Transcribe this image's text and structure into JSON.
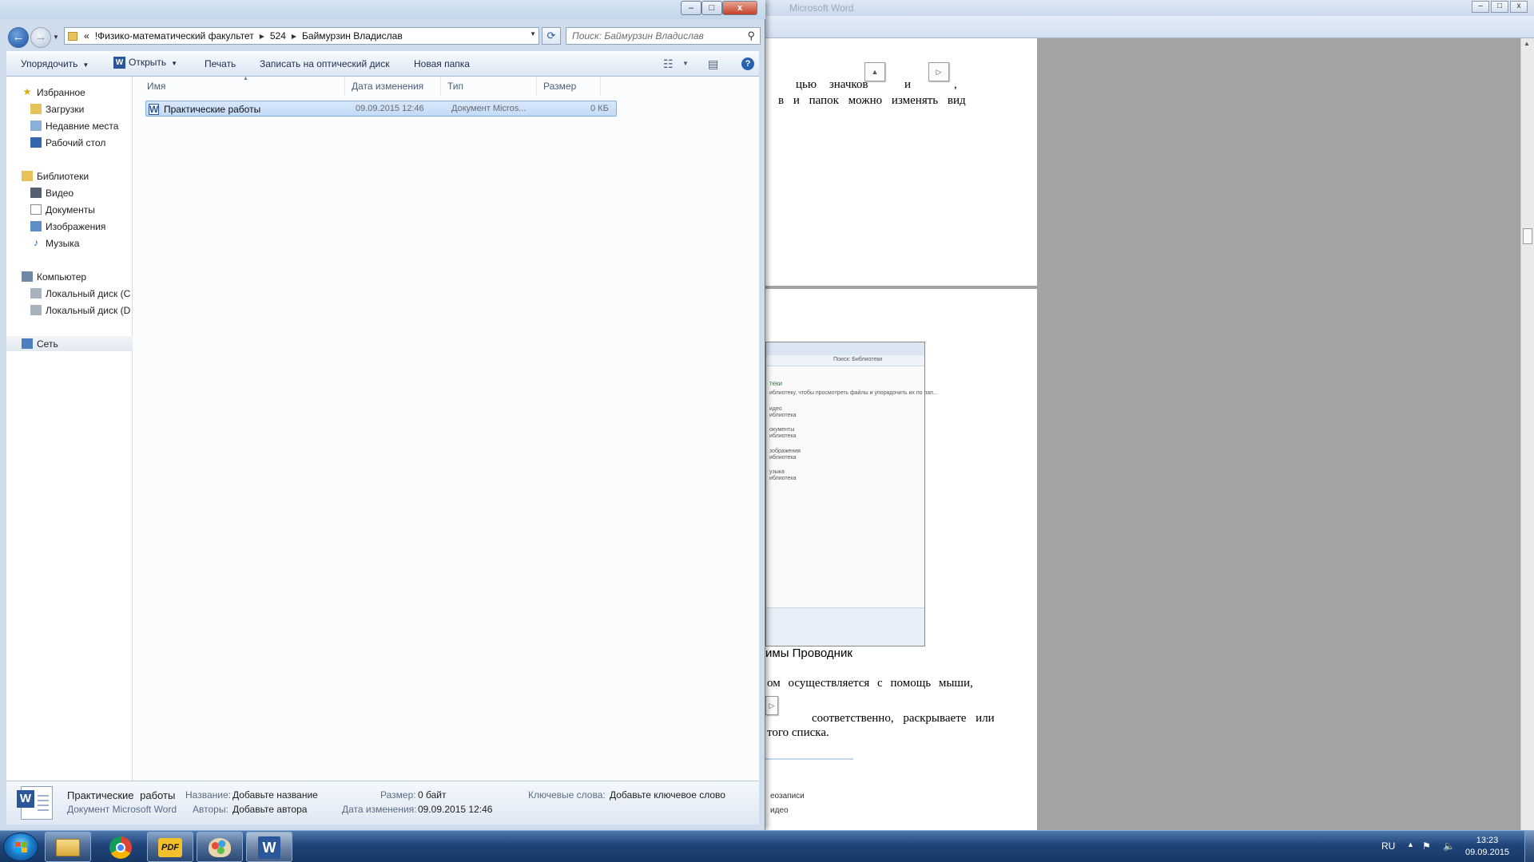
{
  "word": {
    "title": "Microsoft Word",
    "page1_lines": [
      "цью значков",
      "и",
      ",",
      "в и папок можно изменять вид"
    ],
    "page2_lines": [
      "имы Проводник",
      "ом осуществляется с помощь мыши,",
      "соответственно, раскрываете или",
      "того списка."
    ],
    "thumb_labels": [
      "Поиск: Библиотеки",
      "теки",
      "иблиотеку, чтобы просмотреть файлы и упорядочить их по пап...",
      "идео",
      "иблиотека",
      "окументы",
      "иблиотека",
      "зображения",
      "иблиотека",
      "узыка",
      "иблиотека"
    ],
    "thumb2_labels": [
      "еозаписи",
      "идео"
    ]
  },
  "explorer": {
    "title_buttons": {
      "minimize": "–",
      "maximize": "□",
      "close": "x"
    },
    "address": {
      "overflow": "«",
      "segments": [
        "!Физико-математический факультет",
        "524",
        "Баймурзин Владислав"
      ]
    },
    "search": {
      "placeholder": "Поиск: Баймурзин Владислав"
    },
    "commands": {
      "organize": "Упорядочить",
      "open": "Открыть",
      "print": "Печать",
      "burn": "Записать на оптический диск",
      "new_folder": "Новая папка"
    },
    "nav": {
      "favorites": "Избранное",
      "downloads": "Загрузки",
      "recent": "Недавние места",
      "desktop": "Рабочий стол",
      "libraries": "Библиотеки",
      "video": "Видео",
      "documents": "Документы",
      "images": "Изображения",
      "music": "Музыка",
      "computer": "Компьютер",
      "disk_c": "Локальный диск (C",
      "disk_d": "Локальный диск (D",
      "network": "Сеть"
    },
    "columns": {
      "name": "Имя",
      "modified": "Дата изменения",
      "type": "Тип",
      "size": "Размер"
    },
    "files": [
      {
        "name": "Практические  работы",
        "modified": "09.09.2015 12:46",
        "type": "Документ Micros...",
        "size": "0 КБ"
      }
    ],
    "details": {
      "file_name": "Практические  работы",
      "file_type": "Документ Microsoft Word",
      "title_label": "Название:",
      "title_value": "Добавьте название",
      "authors_label": "Авторы:",
      "authors_value": "Добавьте автора",
      "size_label": "Размер:",
      "size_value": "0 байт",
      "modified_label": "Дата изменения:",
      "modified_value": "09.09.2015 12:46",
      "keywords_label": "Ключевые слова:",
      "keywords_value": "Добавьте ключевое слово"
    }
  },
  "taskbar": {
    "apps": [
      "explorer",
      "chrome",
      "pdf",
      "paint",
      "word"
    ],
    "pdf_label": "PDF",
    "word_label": "W",
    "language": "RU",
    "time": "13:23",
    "date": "09.09.2015"
  },
  "colors": {
    "accent": "#2b579a",
    "selection": "#cce0f8",
    "taskbar": "#1f4479"
  }
}
